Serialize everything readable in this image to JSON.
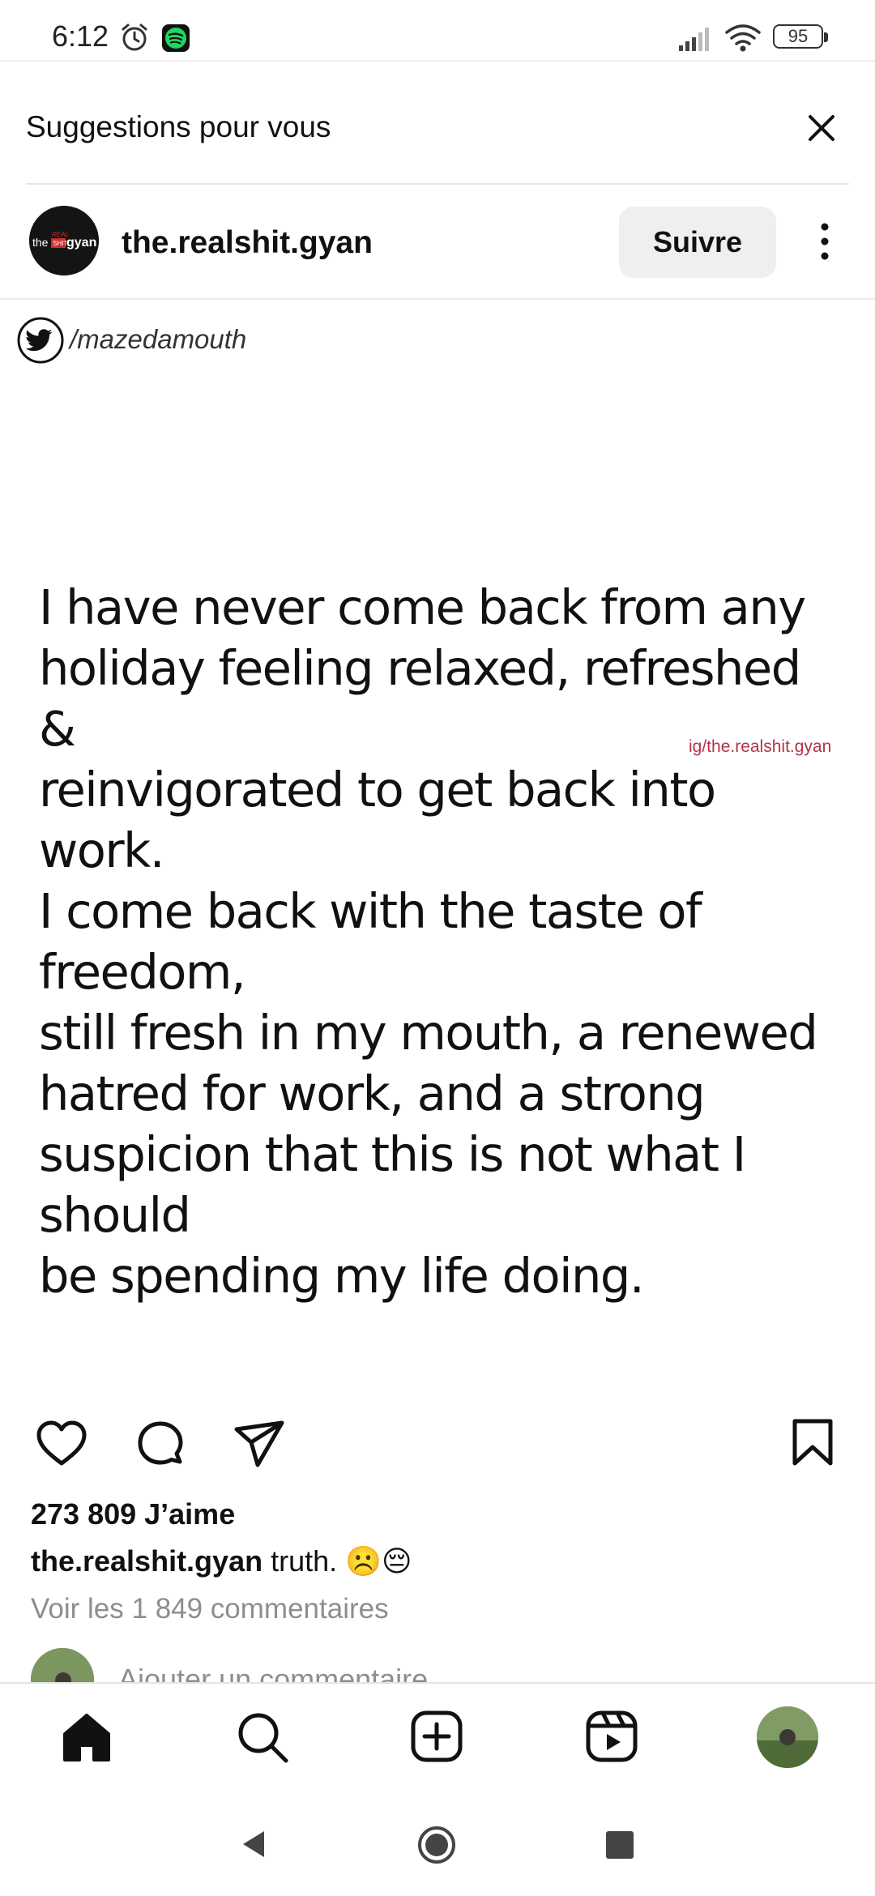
{
  "status_bar": {
    "time": "6:12",
    "battery": "95",
    "icons": [
      "alarm-icon",
      "spotify-icon",
      "signal-icon",
      "wifi-icon",
      "battery-icon"
    ]
  },
  "suggestions": {
    "title": "Suggestions pour vous",
    "close_icon": "close-icon"
  },
  "post": {
    "username": "the.realshit.gyan",
    "follow_label": "Suivre",
    "avatar_logo_text": "the REAL SHIT gyan",
    "image": {
      "twitter_handle": "/mazedamouth",
      "quote": "I have never come back from any\nholiday feeling relaxed, refreshed &\nreinvigorated to get back into work.\nI come back with the taste of freedom,\nstill fresh in my mouth, a renewed\nhatred for work, and a strong\nsuspicion that this is not what I should\nbe spending my life doing.",
      "watermark": "ig/the.realshit.gyan"
    },
    "likes": "273 809 J’aime",
    "caption_user": "the.realshit.gyan",
    "caption_text": " truth. ☹️😔",
    "view_comments": "Voir les 1 849 commentaires",
    "add_comment_placeholder": "Ajouter un commentaire..."
  },
  "bottom_nav": {
    "items": [
      "home-icon",
      "search-icon",
      "create-icon",
      "reels-icon",
      "profile-avatar"
    ]
  },
  "system_nav": {
    "items": [
      "back-icon",
      "home-circle-icon",
      "recents-icon"
    ]
  },
  "colors": {
    "accent_spotify": "#1ed760",
    "watermark": "#b3344a",
    "secondary_text": "#8e8e8e",
    "follow_button_bg": "#efefef"
  }
}
